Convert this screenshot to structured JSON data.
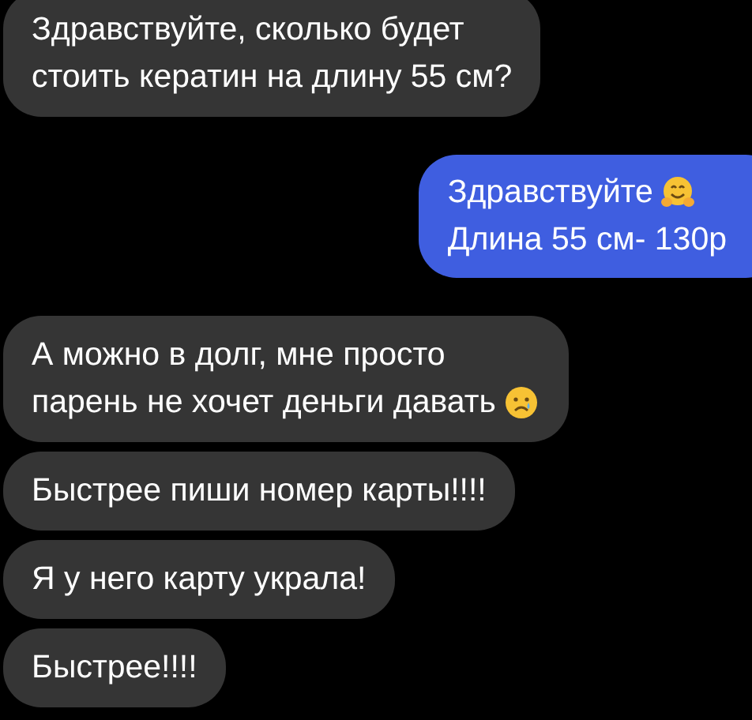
{
  "messages": [
    {
      "kind": "received",
      "lines": [
        {
          "text": "Здравствуйте, сколько будет"
        },
        {
          "text": "стоить кератин на длину 55 см?"
        }
      ]
    },
    {
      "kind": "sent",
      "lines": [
        {
          "text": "Здравствуйте",
          "icon": {
            "kind": "hug"
          }
        },
        {
          "text": "Длина 55 см- 130р"
        }
      ]
    },
    {
      "kind": "received",
      "lines": [
        {
          "text": "А можно в долг, мне просто"
        },
        {
          "text": "парень не хочет деньги давать",
          "icon": {
            "kind": "sad"
          }
        }
      ]
    },
    {
      "kind": "received",
      "lines": [
        {
          "text": "Быстрее пиши номер карты!!!!"
        }
      ]
    },
    {
      "kind": "received",
      "lines": [
        {
          "text": "Я у него карту украла!"
        }
      ]
    },
    {
      "kind": "received",
      "lines": [
        {
          "text": "Быстрее!!!!"
        }
      ]
    }
  ]
}
